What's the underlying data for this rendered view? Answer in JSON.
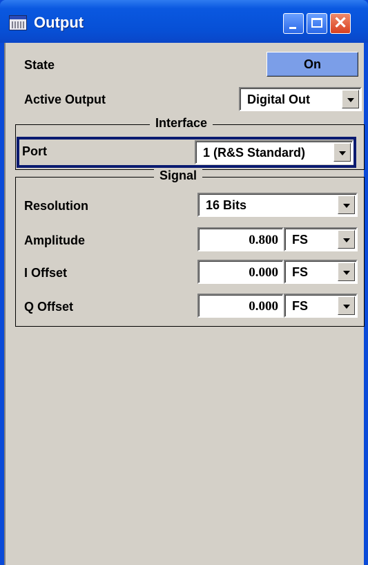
{
  "window": {
    "title": "Output",
    "icon": "app-window-icon"
  },
  "titlebar_buttons": {
    "minimize": "minimize-icon",
    "maximize": "maximize-icon",
    "close": "close-icon",
    "close_glyph": "✕"
  },
  "state": {
    "label": "State",
    "value": "On"
  },
  "active_output": {
    "label": "Active Output",
    "value": "Digital Out"
  },
  "interface": {
    "title": "Interface",
    "port": {
      "label": "Port",
      "value": "1 (R&S Standard)"
    }
  },
  "signal": {
    "title": "Signal",
    "resolution": {
      "label": "Resolution",
      "value": "16 Bits"
    },
    "amplitude": {
      "label": "Amplitude",
      "value": "0.800",
      "unit": "FS"
    },
    "i_offset": {
      "label": "I Offset",
      "value": "0.000",
      "unit": "FS"
    },
    "q_offset": {
      "label": "Q Offset",
      "value": "0.000",
      "unit": "FS"
    }
  },
  "colors": {
    "titlebar": "#0a58e0",
    "on_button": "#7b9ee8",
    "panel": "#d4d0c8",
    "port_highlight": "#0a1a70"
  }
}
